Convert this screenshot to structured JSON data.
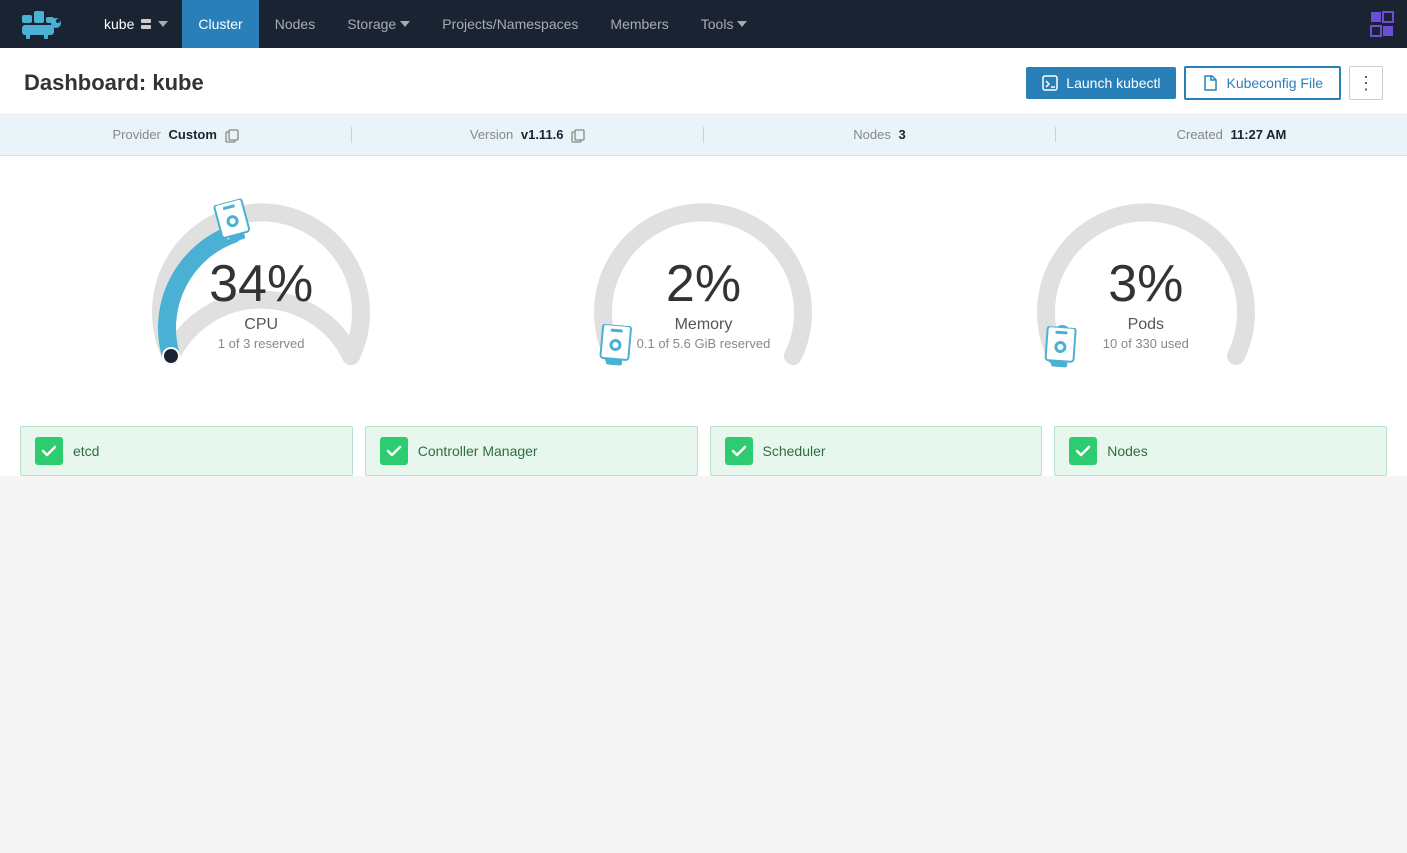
{
  "app": {
    "logo_alt": "Rancher",
    "cluster_name": "kube",
    "nav_items": [
      {
        "label": "Cluster",
        "active": true,
        "has_dropdown": false
      },
      {
        "label": "Nodes",
        "active": false
      },
      {
        "label": "Storage",
        "active": false,
        "has_dropdown": true
      },
      {
        "label": "Projects/Namespaces",
        "active": false
      },
      {
        "label": "Members",
        "active": false
      },
      {
        "label": "Tools",
        "active": false,
        "has_dropdown": true
      }
    ]
  },
  "page": {
    "title_prefix": "Dashboard: ",
    "title_value": "kube",
    "buttons": {
      "launch": "Launch kubectl",
      "kubeconfig": "Kubeconfig File",
      "more": "⋮"
    }
  },
  "info_bar": {
    "provider_label": "Provider",
    "provider_value": "Custom",
    "version_label": "Version",
    "version_value": "v1.11.6",
    "nodes_label": "Nodes",
    "nodes_value": "3",
    "created_label": "Created",
    "created_value": "11:27 AM"
  },
  "gauges": [
    {
      "id": "cpu",
      "percent": "34%",
      "label": "CPU",
      "sublabel": "1 of 3 reserved",
      "value": 34,
      "color": "#4ab0d4",
      "indicator_position": "start"
    },
    {
      "id": "memory",
      "percent": "2%",
      "label": "Memory",
      "sublabel": "0.1 of 5.6 GiB reserved",
      "value": 2,
      "color": "#4ab0d4",
      "indicator_position": "end"
    },
    {
      "id": "pods",
      "percent": "3%",
      "label": "Pods",
      "sublabel": "10 of 330 used",
      "value": 3,
      "color": "#4ab0d4",
      "indicator_position": "end"
    }
  ],
  "status_items": [
    {
      "label": "etcd",
      "ok": true
    },
    {
      "label": "Controller Manager",
      "ok": true
    },
    {
      "label": "Scheduler",
      "ok": true
    },
    {
      "label": "Nodes",
      "ok": true
    }
  ]
}
